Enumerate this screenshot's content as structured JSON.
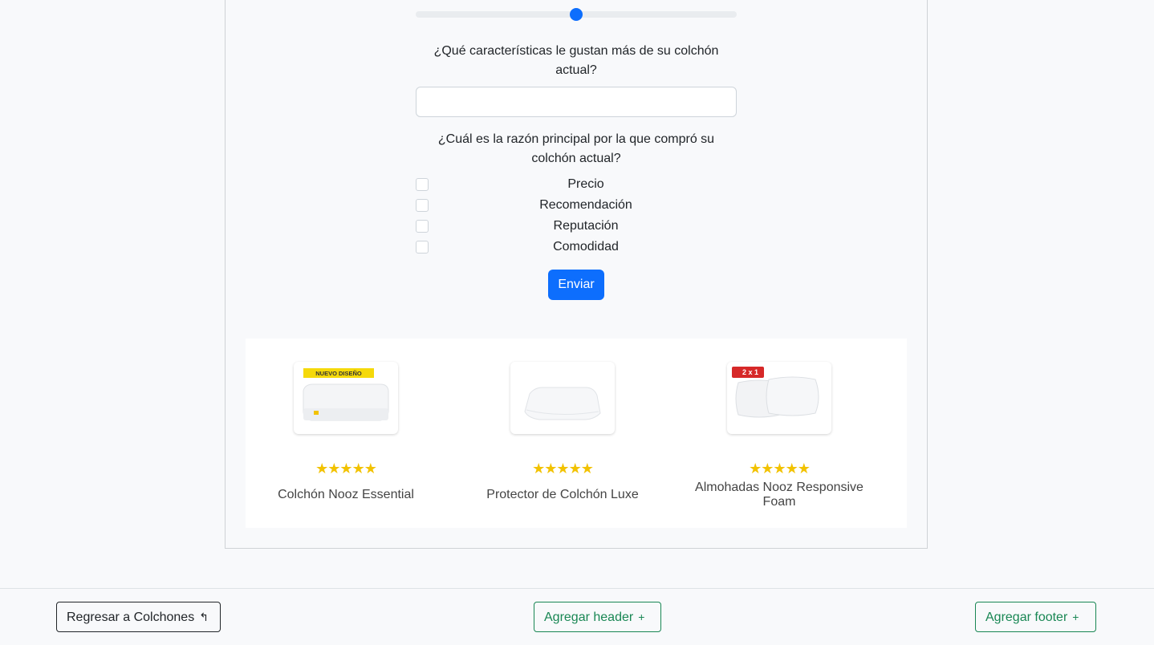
{
  "slider": {
    "value_fraction": 0.5,
    "color": "#0d6efd"
  },
  "questions": {
    "likes": "¿Qué características le gustan más de su colchón actual?",
    "likes_input_value": "",
    "reason": "¿Cuál es la razón principal por la que compró su colchón actual?"
  },
  "options": [
    {
      "label": "Precio",
      "checked": false
    },
    {
      "label": "Recomendación",
      "checked": false
    },
    {
      "label": "Reputación",
      "checked": false
    },
    {
      "label": "Comodidad",
      "checked": false
    }
  ],
  "submit_label": "Enviar",
  "products": [
    {
      "name": "Colchón Nooz Essential",
      "badge": "NUEVO DISEÑO",
      "rating": 5,
      "stars": "★★★★★"
    },
    {
      "name": "Protector de Colchón Luxe",
      "badge": "",
      "rating": 5,
      "stars": "★★★★★"
    },
    {
      "name": "Almohadas Nooz Responsive Foam",
      "badge": "2 x 1",
      "rating": 5,
      "stars": "★★★★★"
    }
  ],
  "footer": {
    "back_label": "Regresar a Colchones",
    "back_icon": "return-arrow-icon",
    "add_header_label": "Agregar header",
    "add_footer_label": "Agregar footer",
    "add_icon": "plus-icon"
  },
  "colors": {
    "primary": "#0d6efd",
    "success": "#198754",
    "star": "#f2c200"
  }
}
